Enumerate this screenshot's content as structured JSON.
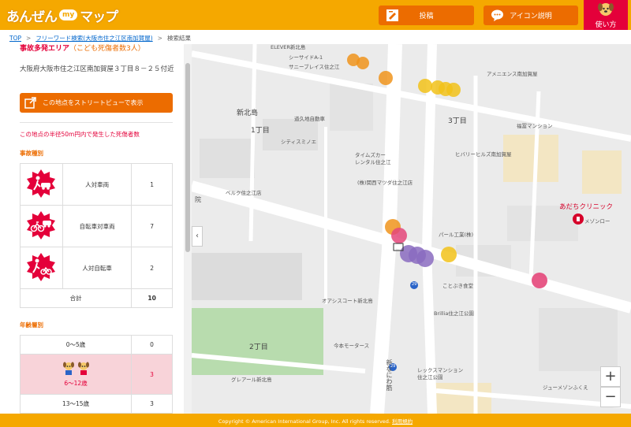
{
  "header": {
    "logo_part1": "あんぜん",
    "logo_my": "my",
    "logo_part2": "マップ",
    "post_label": "投稿",
    "icon_help_label": "アイコン説明",
    "howto_label": "使い方"
  },
  "breadcrumb": {
    "top": "TOP",
    "search": "フリーワード検索(大阪市住之江区南加賀屋)",
    "current": "検索結果"
  },
  "sidebar": {
    "area_title": "事故多発エリア",
    "area_sub": "（こども死傷者数3人）",
    "address": "大阪府大阪市住之江区南加賀屋３丁目８－２５付近",
    "streetview_label": "この地点をストリートビューで表示",
    "radius_note": "この地点の半径50m円内で発生した死傷者数",
    "type_title": "事故種別",
    "types": [
      {
        "icon": "pedestrian-vs-car-icon",
        "label": "人対車両",
        "count": "1"
      },
      {
        "icon": "bicycle-vs-car-icon",
        "label": "自転車対車両",
        "count": "7"
      },
      {
        "icon": "pedestrian-vs-bicycle-icon",
        "label": "人対自転車",
        "count": "2"
      }
    ],
    "total_label": "合計",
    "total_count": "10",
    "age_title": "年齢層別",
    "ages": [
      {
        "label": "0～5歳",
        "count": "0"
      },
      {
        "label": "6～12歳",
        "count": "3"
      },
      {
        "label": "13～15歳",
        "count": "3"
      }
    ]
  },
  "map": {
    "labels": {
      "elever": "ELEVER新北島",
      "seaside": "シーサイドA-1",
      "sunny": "サニーブレイス住之江",
      "amenities": "アメニエンス南加賀屋",
      "shinkita": "新北島",
      "chome1": "1丁目",
      "chome3a": "3丁目",
      "chome3b": "3丁目",
      "doku": "道久地自動車",
      "fukujin": "福冨マンション",
      "city": "シティスミノエ",
      "times": "タイムズカー\nレンタル住之江",
      "hibari": "ヒバリーヒルズ南加賀屋",
      "kansai": "(株)関西マツダ住之江店",
      "bell": "ベルク住之江店",
      "adachi": "あだちクリニック",
      "mezon": "メゾンロー",
      "parl": "パール工業(株)",
      "kotobuki": "ことぶき食堂",
      "ocean": "オアシスコート新北島",
      "brillia": "Brillia住之江公園",
      "imamoto": "今本モータース",
      "chome2": "2丁目",
      "glair": "グレアール新北島",
      "lex": "レックスマンション\n住之江公園",
      "jew": "ジューメゾンふくえ",
      "route": "新なにわ筋",
      "r29a": "29",
      "r29b": "29",
      "hou": "院"
    },
    "zoom_in": "+",
    "zoom_out": "−",
    "collapse": "‹",
    "colors": {
      "orange": "#f0941c",
      "yellow": "#f2c21a",
      "purple": "#8a6bbf",
      "pink": "#e4477a"
    }
  },
  "footer": {
    "copyright": "Copyright © American International Group, Inc. All rights reserved.",
    "terms": "利用規約"
  }
}
